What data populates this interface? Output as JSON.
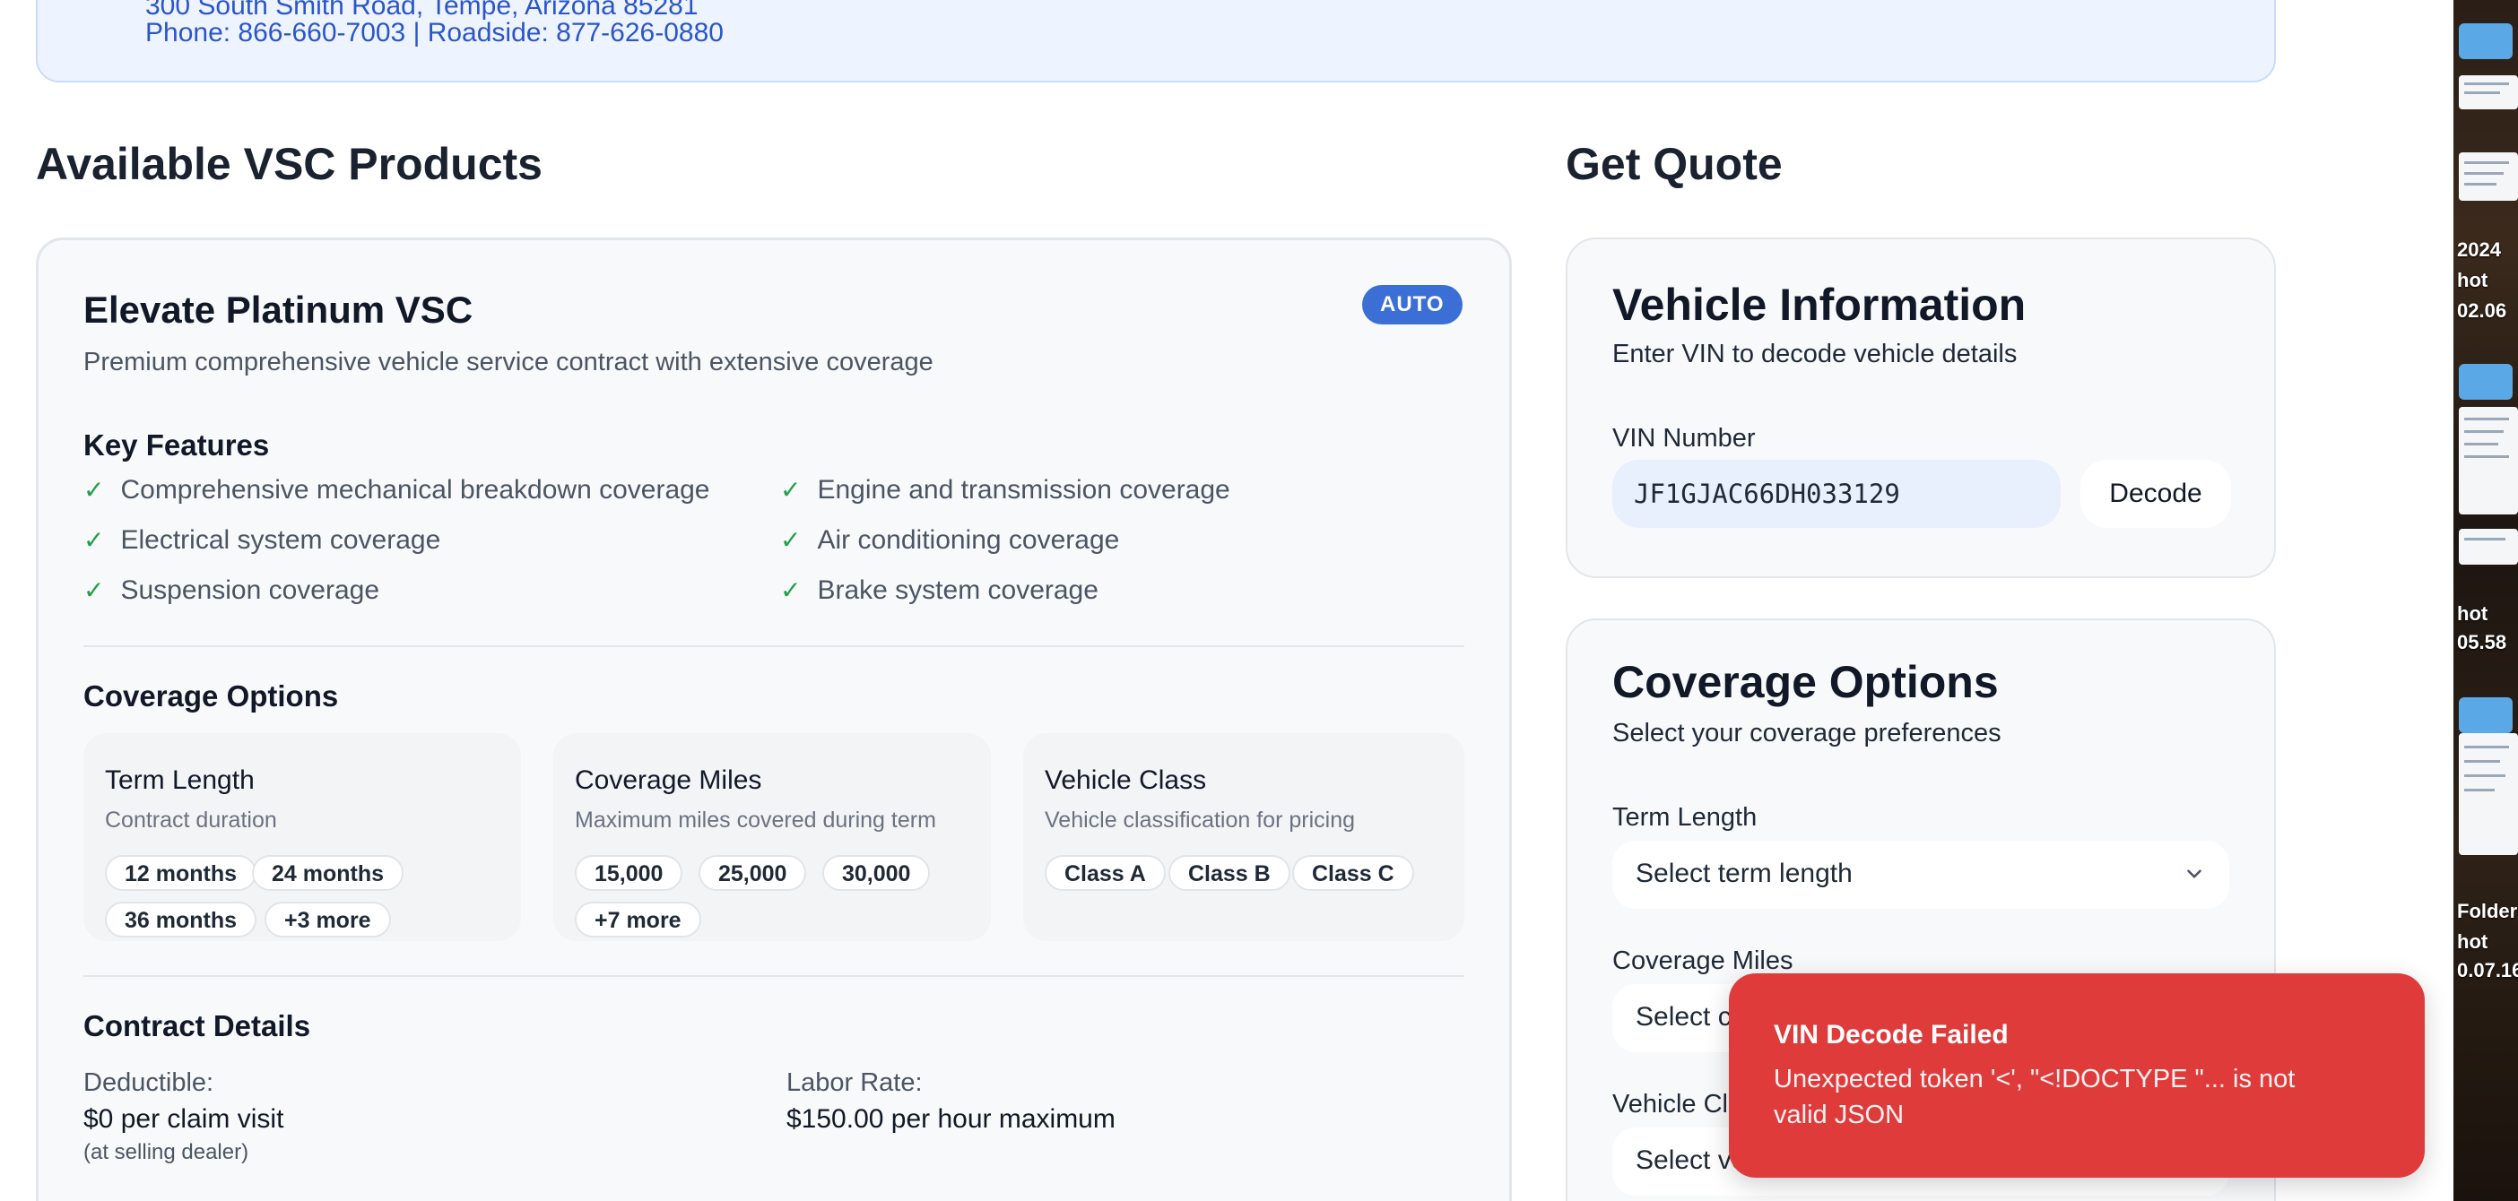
{
  "header": {
    "address": "300 South Smith Road, Tempe, Arizona 85281",
    "phone_line": "Phone: 866-660-7003 | Roadside: 877-626-0880"
  },
  "products": {
    "section_title": "Available VSC Products",
    "card": {
      "name": "Elevate Platinum VSC",
      "description": "Premium comprehensive vehicle service contract with extensive coverage",
      "badge": "AUTO",
      "features_title": "Key Features",
      "features": [
        "Comprehensive mechanical breakdown coverage",
        "Engine and transmission coverage",
        "Electrical system coverage",
        "Air conditioning coverage",
        "Suspension coverage",
        "Brake system coverage"
      ],
      "coverage_title": "Coverage Options",
      "options": [
        {
          "title": "Term Length",
          "subtitle": "Contract duration",
          "chips": [
            "12 months",
            "24 months",
            "36 months",
            "+3 more"
          ]
        },
        {
          "title": "Coverage Miles",
          "subtitle": "Maximum miles covered during term",
          "chips": [
            "15,000",
            "25,000",
            "30,000",
            "+7 more"
          ]
        },
        {
          "title": "Vehicle Class",
          "subtitle": "Vehicle classification for pricing",
          "chips": [
            "Class A",
            "Class B",
            "Class C"
          ]
        }
      ],
      "contract_title": "Contract Details",
      "deductible_label": "Deductible:",
      "deductible_value": "$0 per claim visit",
      "deductible_note": "(at selling dealer)",
      "labor_label": "Labor Rate:",
      "labor_value": "$150.00 per hour maximum"
    }
  },
  "quote": {
    "section_title": "Get Quote",
    "vehicle": {
      "title": "Vehicle Information",
      "subtitle": "Enter VIN to decode vehicle details",
      "vin_label": "VIN Number",
      "vin_value": "JF1GJAC66DH033129",
      "decode_label": "Decode"
    },
    "coverage": {
      "title": "Coverage Options",
      "subtitle": "Select your coverage preferences",
      "term_label": "Term Length",
      "term_placeholder": "Select term length",
      "miles_label": "Coverage Miles",
      "miles_placeholder": "Select c",
      "class_label": "Vehicle Cl",
      "class_placeholder": "Select ve"
    }
  },
  "toast": {
    "title": "VIN Decode Failed",
    "message": "Unexpected token '<', \"<!DOCTYPE \"... is not valid JSON"
  },
  "desktop": {
    "labels": [
      "2024",
      "hot",
      "02.06",
      "hot",
      "05.58",
      "Folder",
      "hot",
      "0.07.16"
    ]
  },
  "colors": {
    "accent": "#3b6fd6",
    "link_blue": "#2b55c9",
    "check_green": "#22a04b",
    "error_red": "#e03b3b",
    "banner_bg": "#eef4ff"
  }
}
